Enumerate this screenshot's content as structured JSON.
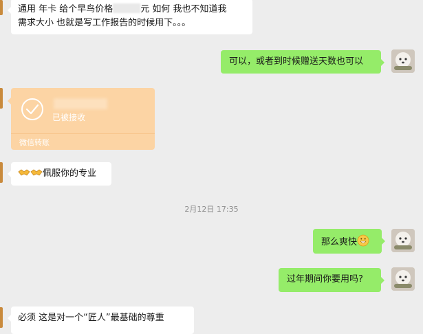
{
  "messages": {
    "m1_line1_a": "通用 年卡  给个早鸟价格",
    "m1_line1_b": "元 如何   我也不知道我",
    "m1_line2": "需求大小  也就是写工作报告的时候用下。。。",
    "m2": "可以，或者到时候赠送天数也可以",
    "m3_status": "已被接收",
    "m3_footer": "微信转账",
    "m4": "佩服你的专业",
    "timestamp": "2月12日 17:35",
    "m5": "那么爽快",
    "m6": "过年期间你要用吗?",
    "m7": "必须 这是对一个“匠人”最基础的尊重"
  },
  "icons": {
    "transfer": "check-circle-icon",
    "handshake": "handshake-emoji",
    "grin": "grin-emoji"
  },
  "colors": {
    "background": "#ededed",
    "incoming_bubble": "#ffffff",
    "outgoing_bubble": "#95ec69",
    "transfer_bubble": "#fcd4a4"
  }
}
